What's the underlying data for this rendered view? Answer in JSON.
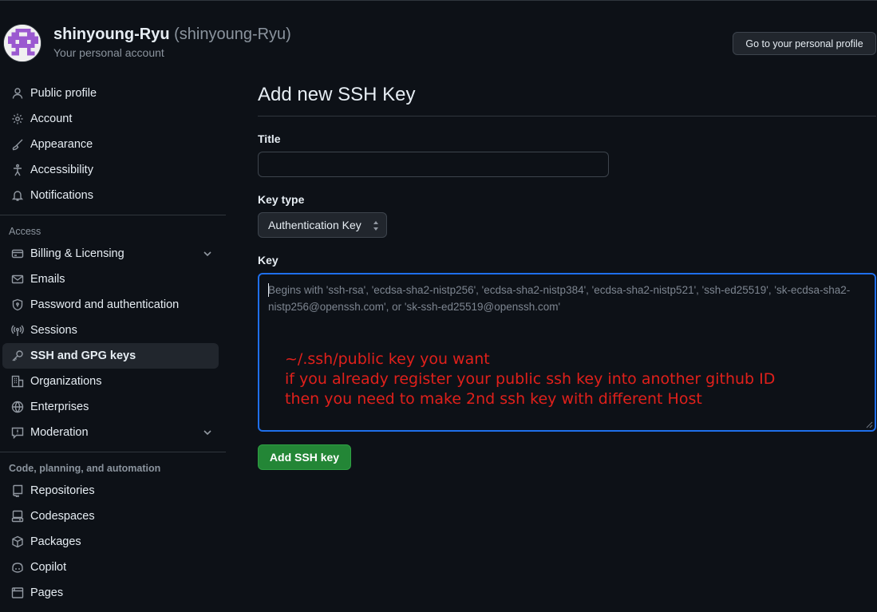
{
  "header": {
    "display_name": "shinyoung-Ryu",
    "login": "(shinyoung-Ryu)",
    "subtitle": "Your personal account",
    "profile_button": "Go to your personal profile"
  },
  "sidebar": {
    "top_items": [
      {
        "label": "Public profile",
        "icon": "person-icon"
      },
      {
        "label": "Account",
        "icon": "gear-icon"
      },
      {
        "label": "Appearance",
        "icon": "paintbrush-icon"
      },
      {
        "label": "Accessibility",
        "icon": "accessibility-icon"
      },
      {
        "label": "Notifications",
        "icon": "bell-icon"
      }
    ],
    "access_title": "Access",
    "access_items": [
      {
        "label": "Billing & Licensing",
        "icon": "credit-card-icon",
        "expandable": true
      },
      {
        "label": "Emails",
        "icon": "mail-icon"
      },
      {
        "label": "Password and authentication",
        "icon": "shield-lock-icon"
      },
      {
        "label": "Sessions",
        "icon": "broadcast-icon"
      },
      {
        "label": "SSH and GPG keys",
        "icon": "key-icon",
        "selected": true
      },
      {
        "label": "Organizations",
        "icon": "organization-icon"
      },
      {
        "label": "Enterprises",
        "icon": "globe-icon"
      },
      {
        "label": "Moderation",
        "icon": "report-icon",
        "expandable": true
      }
    ],
    "code_title": "Code, planning, and automation",
    "code_items": [
      {
        "label": "Repositories",
        "icon": "repo-icon"
      },
      {
        "label": "Codespaces",
        "icon": "codespaces-icon"
      },
      {
        "label": "Packages",
        "icon": "package-icon"
      },
      {
        "label": "Copilot",
        "icon": "copilot-icon"
      },
      {
        "label": "Pages",
        "icon": "browser-icon"
      }
    ]
  },
  "main": {
    "heading": "Add new SSH Key",
    "title_label": "Title",
    "title_value": "",
    "key_type_label": "Key type",
    "key_type_selected": "Authentication Key",
    "key_label": "Key",
    "key_placeholder": "Begins with 'ssh-rsa', 'ecdsa-sha2-nistp256', 'ecdsa-sha2-nistp384', 'ecdsa-sha2-nistp521', 'ssh-ed25519', 'sk-ecdsa-sha2-nistp256@openssh.com', or 'sk-ssh-ed25519@openssh.com'",
    "annotation_lines": [
      "~/.ssh/public key you want",
      "if you already register your public ssh key into another github ID",
      "then you need to make 2nd ssh key with different Host"
    ],
    "submit_label": "Add SSH key"
  },
  "colors": {
    "background": "#0d1117",
    "accent_blue": "#1f6feb",
    "button_green": "#238636",
    "annotation_red": "#e0201b"
  }
}
